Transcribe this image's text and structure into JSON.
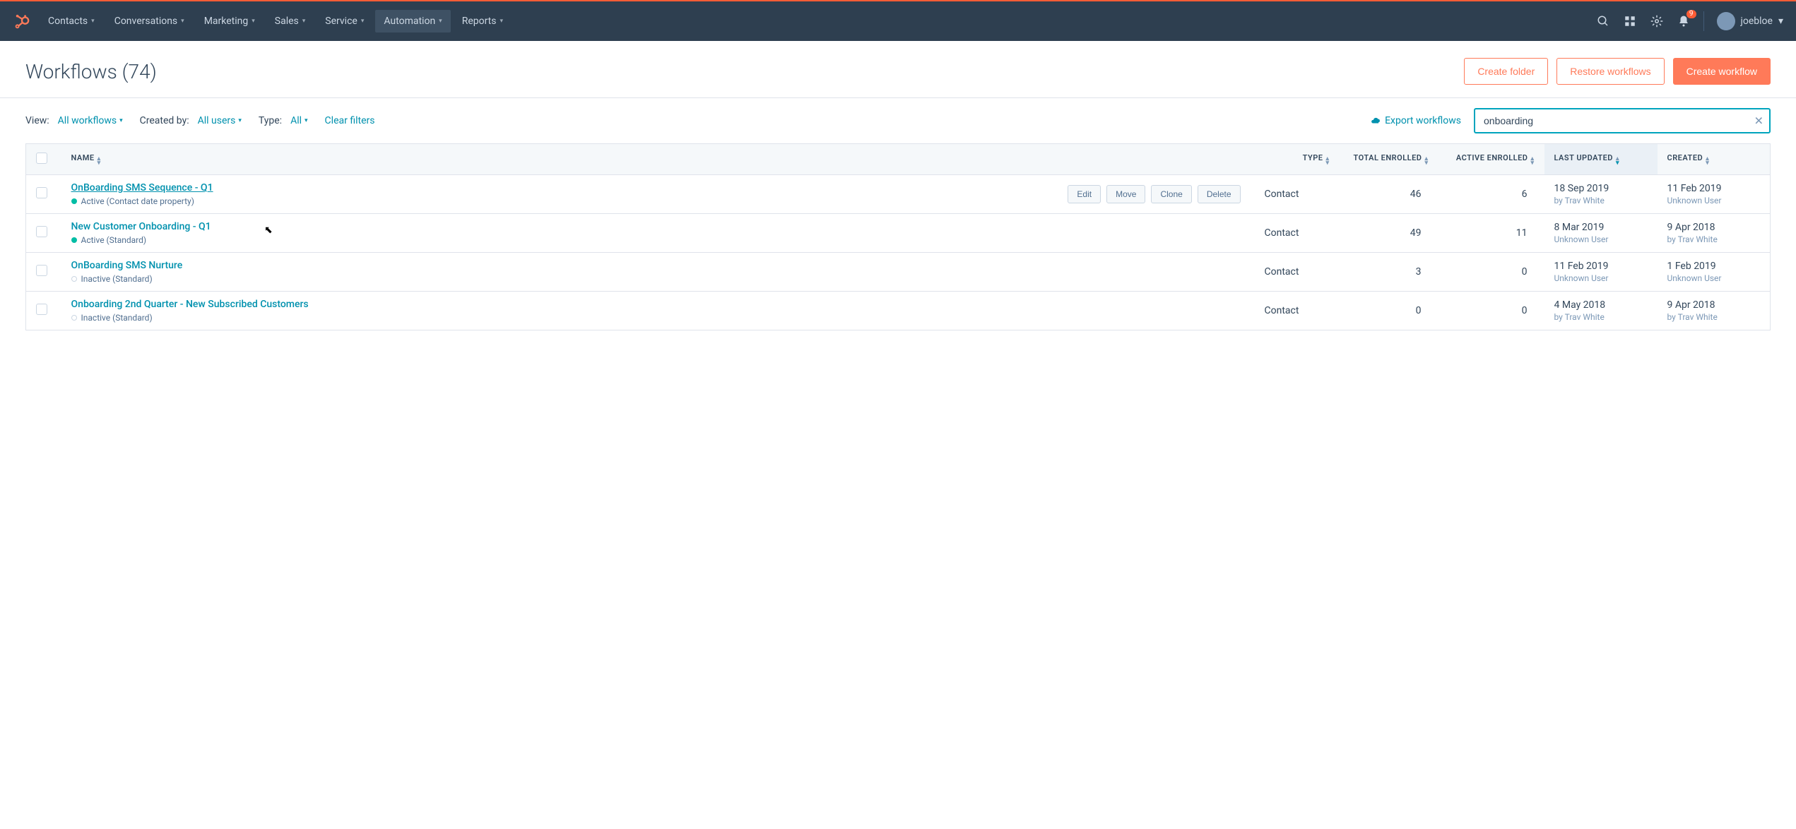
{
  "nav": {
    "items": [
      "Contacts",
      "Conversations",
      "Marketing",
      "Sales",
      "Service",
      "Automation",
      "Reports"
    ],
    "activeIndex": 5,
    "notificationCount": "9",
    "username": "joebloe"
  },
  "page": {
    "title": "Workflows (74)",
    "actions": {
      "createFolder": "Create folder",
      "restore": "Restore workflows",
      "create": "Create workflow"
    }
  },
  "filters": {
    "viewLabel": "View:",
    "viewValue": "All workflows",
    "createdByLabel": "Created by:",
    "createdByValue": "All users",
    "typeLabel": "Type:",
    "typeValue": "All",
    "clear": "Clear filters",
    "export": "Export workflows",
    "searchValue": "onboarding"
  },
  "table": {
    "headers": {
      "name": "NAME",
      "type": "TYPE",
      "totalEnrolled": "TOTAL ENROLLED",
      "activeEnrolled": "ACTIVE ENROLLED",
      "lastUpdated": "LAST UPDATED",
      "created": "CREATED"
    },
    "rowActions": {
      "edit": "Edit",
      "move": "Move",
      "clone": "Clone",
      "delete": "Delete"
    },
    "rows": [
      {
        "name": "OnBoarding SMS Sequence - Q1",
        "statusActive": true,
        "statusText": "Active (Contact date property)",
        "type": "Contact",
        "totalEnrolled": "46",
        "activeEnrolled": "6",
        "updatedDate": "18 Sep 2019",
        "updatedBy": "by Trav White",
        "createdDate": "11 Feb 2019",
        "createdBy": "Unknown User",
        "hovered": true
      },
      {
        "name": "New Customer Onboarding - Q1",
        "statusActive": true,
        "statusText": "Active (Standard)",
        "type": "Contact",
        "totalEnrolled": "49",
        "activeEnrolled": "11",
        "updatedDate": "8 Mar 2019",
        "updatedBy": "Unknown User",
        "createdDate": "9 Apr 2018",
        "createdBy": "by Trav White",
        "hovered": false
      },
      {
        "name": "OnBoarding SMS Nurture",
        "statusActive": false,
        "statusText": "Inactive (Standard)",
        "type": "Contact",
        "totalEnrolled": "3",
        "activeEnrolled": "0",
        "updatedDate": "11 Feb 2019",
        "updatedBy": "Unknown User",
        "createdDate": "1 Feb 2019",
        "createdBy": "Unknown User",
        "hovered": false
      },
      {
        "name": "Onboarding 2nd Quarter - New Subscribed Customers",
        "statusActive": false,
        "statusText": "Inactive (Standard)",
        "type": "Contact",
        "totalEnrolled": "0",
        "activeEnrolled": "0",
        "updatedDate": "4 May 2018",
        "updatedBy": "by Trav White",
        "createdDate": "9 Apr 2018",
        "createdBy": "by Trav White",
        "hovered": false
      }
    ]
  }
}
